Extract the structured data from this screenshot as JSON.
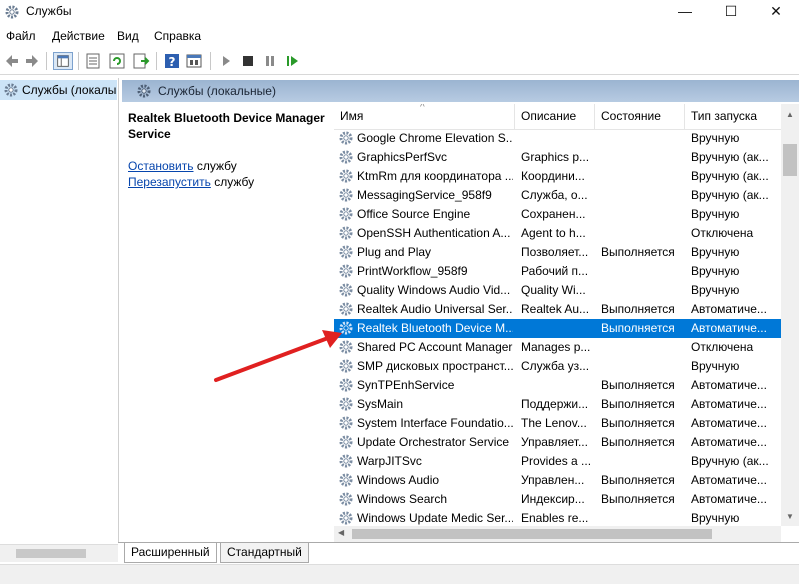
{
  "window": {
    "title": "Службы",
    "minimize_glyph": "—",
    "maximize_glyph": "☐",
    "close_glyph": "✕"
  },
  "menu": [
    "Файл",
    "Действие",
    "Вид",
    "Справка"
  ],
  "toolbar_icons": [
    "back-icon",
    "forward-icon",
    "show-tree-icon",
    "properties-icon",
    "refresh-icon",
    "export-icon",
    "help-icon",
    "console-icon",
    "start-icon",
    "stop-icon",
    "pause-icon",
    "restart-icon"
  ],
  "tree": {
    "root_label": "Службы (локалы"
  },
  "panel": {
    "header": "Службы (локальные)",
    "selected_service_title": "Realtek Bluetooth Device Manager Service",
    "stop_link": "Остановить",
    "stop_suffix": " службу",
    "restart_link": "Перезапустить",
    "restart_suffix": " службу"
  },
  "columns": [
    "Имя",
    "Описание",
    "Состояние",
    "Тип запуска"
  ],
  "services": [
    {
      "name": "Google Chrome Elevation S...",
      "desc": "",
      "status": "",
      "startup": "Вручную"
    },
    {
      "name": "GraphicsPerfSvc",
      "desc": "Graphics p...",
      "status": "",
      "startup": "Вручную (ак..."
    },
    {
      "name": "KtmRm для координатора ...",
      "desc": "Координи...",
      "status": "",
      "startup": "Вручную (ак..."
    },
    {
      "name": "MessagingService_958f9",
      "desc": "Служба, о...",
      "status": "",
      "startup": "Вручную (ак..."
    },
    {
      "name": "Office Source Engine",
      "desc": "Сохранен...",
      "status": "",
      "startup": "Вручную"
    },
    {
      "name": "OpenSSH Authentication A...",
      "desc": "Agent to h...",
      "status": "",
      "startup": "Отключена"
    },
    {
      "name": "Plug and Play",
      "desc": "Позволяет...",
      "status": "Выполняется",
      "startup": "Вручную"
    },
    {
      "name": "PrintWorkflow_958f9",
      "desc": "Рабочий п...",
      "status": "",
      "startup": "Вручную"
    },
    {
      "name": "Quality Windows Audio Vid...",
      "desc": "Quality Wi...",
      "status": "",
      "startup": "Вручную"
    },
    {
      "name": "Realtek Audio Universal Ser...",
      "desc": "Realtek Au...",
      "status": "Выполняется",
      "startup": "Автоматиче..."
    },
    {
      "name": "Realtek Bluetooth Device M...",
      "desc": "",
      "status": "Выполняется",
      "startup": "Автоматиче...",
      "selected": true
    },
    {
      "name": "Shared PC Account Manager",
      "desc": "Manages p...",
      "status": "",
      "startup": "Отключена"
    },
    {
      "name": "SMP дисковых пространст...",
      "desc": "Служба уз...",
      "status": "",
      "startup": "Вручную"
    },
    {
      "name": "SynTPEnhService",
      "desc": "",
      "status": "Выполняется",
      "startup": "Автоматиче..."
    },
    {
      "name": "SysMain",
      "desc": "Поддержи...",
      "status": "Выполняется",
      "startup": "Автоматиче..."
    },
    {
      "name": "System Interface Foundatio...",
      "desc": "The Lenov...",
      "status": "Выполняется",
      "startup": "Автоматиче..."
    },
    {
      "name": "Update Orchestrator Service",
      "desc": "Управляет...",
      "status": "Выполняется",
      "startup": "Автоматиче..."
    },
    {
      "name": "WarpJITSvc",
      "desc": "Provides a ...",
      "status": "",
      "startup": "Вручную (ак..."
    },
    {
      "name": "Windows Audio",
      "desc": "Управлен...",
      "status": "Выполняется",
      "startup": "Автоматиче..."
    },
    {
      "name": "Windows Search",
      "desc": "Индексир...",
      "status": "Выполняется",
      "startup": "Автоматиче..."
    },
    {
      "name": "Windows Update Medic Ser...",
      "desc": "Enables re...",
      "status": "",
      "startup": "Вручную"
    }
  ],
  "tabs": [
    "Расширенный",
    "Стандартный"
  ],
  "colors": {
    "selection": "#0078d7",
    "annotation_arrow": "#e02020",
    "link": "#0645ad"
  }
}
